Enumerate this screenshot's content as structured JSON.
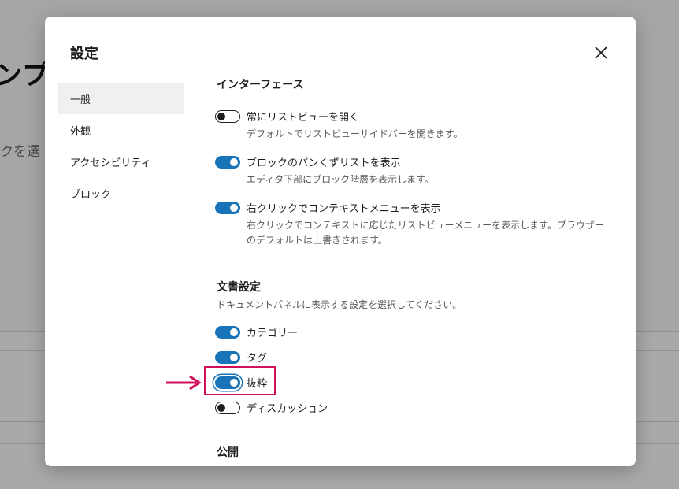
{
  "background": {
    "title_fragment": "ンプ",
    "subtitle_fragment": "クを選"
  },
  "modal": {
    "title": "設定",
    "close_icon": "close-icon"
  },
  "sidebar": {
    "items": [
      {
        "label": "一般",
        "active": true
      },
      {
        "label": "外観",
        "active": false
      },
      {
        "label": "アクセシビリティ",
        "active": false
      },
      {
        "label": "ブロック",
        "active": false
      }
    ]
  },
  "interface": {
    "title": "インターフェース",
    "options": [
      {
        "label": "常にリストビューを開く",
        "help": "デフォルトでリストビューサイドバーを開きます。",
        "checked": false
      },
      {
        "label": "ブロックのパンくずリストを表示",
        "help": "エディタ下部にブロック階層を表示します。",
        "checked": true
      },
      {
        "label": "右クリックでコンテキストメニューを表示",
        "help": "右クリックでコンテキストに応じたリストビューメニューを表示します。ブラウザーのデフォルトは上書きされます。",
        "checked": true
      }
    ]
  },
  "document": {
    "title": "文書設定",
    "desc": "ドキュメントパネルに表示する設定を選択してください。",
    "options": [
      {
        "label": "カテゴリー",
        "checked": true
      },
      {
        "label": "タグ",
        "checked": true
      },
      {
        "label": "抜粋",
        "checked": true
      },
      {
        "label": "ディスカッション",
        "checked": false
      }
    ]
  },
  "publish": {
    "title": "公開"
  },
  "colors": {
    "accent": "#1873b8",
    "highlight": "#d0105a"
  }
}
